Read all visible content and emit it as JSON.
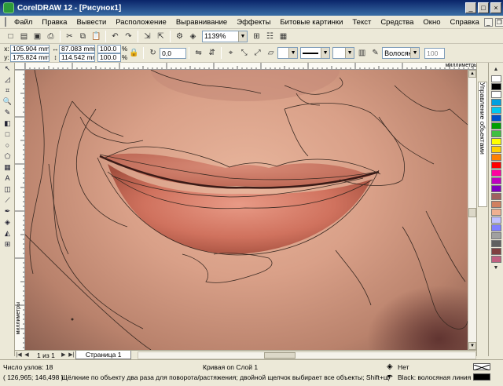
{
  "window": {
    "title": "CorelDRAW 12 - [Рисунок1]"
  },
  "menu": [
    "Файл",
    "Правка",
    "Вывести",
    "Расположение",
    "Выравнивание",
    "Эффекты",
    "Битовые картинки",
    "Текст",
    "Средства",
    "Окно",
    "Справка"
  ],
  "toolbar": {
    "zoom": "1139%"
  },
  "props": {
    "x": "105.904 mm",
    "y": "175.824 mm",
    "w": "87.083 mm",
    "h": "114.542 mm",
    "scale_w": "100.0",
    "scale_h": "100.0",
    "scale_unit": "%",
    "angle": "0,0",
    "outline_width": "Волосян...",
    "percent": "100"
  },
  "rulers": {
    "unit_top": "миллиметры",
    "unit_left": "миллиметры",
    "unit_corner": "миллиметры"
  },
  "docker": {
    "label": "Управление объектами"
  },
  "pages": {
    "count": "1 из 1",
    "tab": "Страница 1"
  },
  "status": {
    "nodes": "Число узлов: 18",
    "layer": "Кривая on Слой 1",
    "coords": "( 126,965; 146,498 )",
    "hint": "Щёлкние по объекту два раза для поворота/растяжения; двойной щелчок выбирает все объекты; Shift+щелчок - выбор не...",
    "fill": "Нет",
    "outline": "Black: волосяная линия"
  },
  "palette": [
    "#ffffff",
    "#000000",
    "#ffffff",
    "#00a0e0",
    "#00c8f0",
    "#0050c8",
    "#00a000",
    "#40c040",
    "#ffff00",
    "#ffd000",
    "#ff8000",
    "#ff0000",
    "#ff00a0",
    "#c000c0",
    "#8000c0",
    "#a06060",
    "#d08060",
    "#f0b090",
    "#c0c0ff",
    "#8080ff",
    "#a0a0a0",
    "#606060",
    "#804040",
    "#c06080"
  ]
}
